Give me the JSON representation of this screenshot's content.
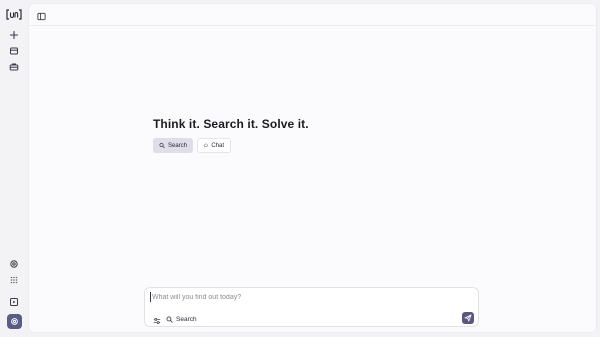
{
  "app": {
    "logo_text": "[un]",
    "accent_color": "#5c5a87"
  },
  "rail": {
    "items": [
      {
        "icon": "plus-icon"
      },
      {
        "icon": "inbox-icon"
      },
      {
        "icon": "briefcase-icon"
      },
      {
        "icon": "settings-gear-icon"
      },
      {
        "icon": "apps-grid-icon"
      },
      {
        "icon": "play-square-icon"
      },
      {
        "icon": "profile-gear-icon"
      }
    ]
  },
  "header": {
    "sidebar_toggle_icon": "sidebar-toggle-icon"
  },
  "main": {
    "headline": "Think it. Search it. Solve it.",
    "modes": [
      {
        "label": "Search",
        "icon": "search-icon",
        "selected": true
      },
      {
        "label": "Chat",
        "icon": "chat-bubble-icon",
        "selected": false
      }
    ]
  },
  "composer": {
    "placeholder": "What will you find out today?",
    "value": "",
    "search_label": "Search",
    "send_icon": "send-icon"
  }
}
